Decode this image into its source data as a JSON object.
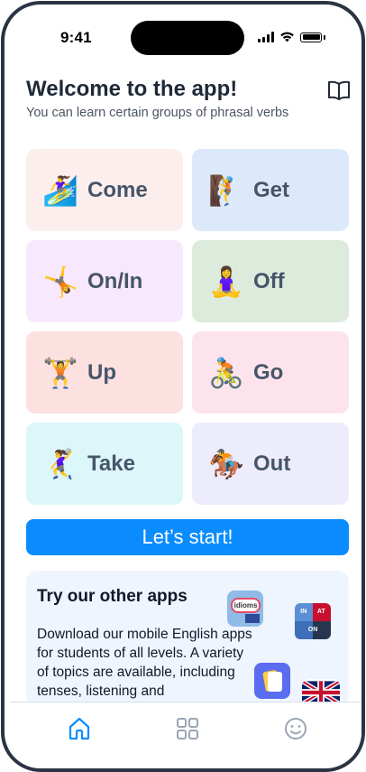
{
  "status_bar": {
    "time": "9:41"
  },
  "header": {
    "title": "Welcome to the app!",
    "subtitle": "You can learn certain groups of phrasal verbs"
  },
  "verbs": [
    {
      "label": "Come",
      "emoji": "🏄‍♀️",
      "bg": "#fdeeee"
    },
    {
      "label": "Get",
      "emoji": "🧗",
      "bg": "#dce9fb"
    },
    {
      "label": "On/In",
      "emoji": "🤸",
      "bg": "#f8e8fd"
    },
    {
      "label": "Off",
      "emoji": "🧘‍♀️",
      "bg": "#dcebdc"
    },
    {
      "label": "Up",
      "emoji": "🏋️",
      "bg": "#fde0e0"
    },
    {
      "label": "Go",
      "emoji": "🚴",
      "bg": "#fde4ec"
    },
    {
      "label": "Take",
      "emoji": "🤾‍♀️",
      "bg": "#dbf7fa"
    },
    {
      "label": "Out",
      "emoji": "🏇",
      "bg": "#ececfd"
    }
  ],
  "cta": {
    "label": "Let’s start!"
  },
  "promo": {
    "title": "Try our other apps",
    "text": "Download our mobile English apps for students of all levels. A variety of topics are available, including tenses, listening and",
    "apps": [
      {
        "name": "idioms-app-icon",
        "text": "idioms"
      },
      {
        "name": "prepositions-app-icon",
        "text": "IN AT ON"
      },
      {
        "name": "flashcards-app-icon"
      },
      {
        "name": "uk-flag-app-icon"
      }
    ]
  },
  "tabbar": {
    "active_color": "#0a8cff",
    "inactive_color": "#9aa5b4"
  }
}
